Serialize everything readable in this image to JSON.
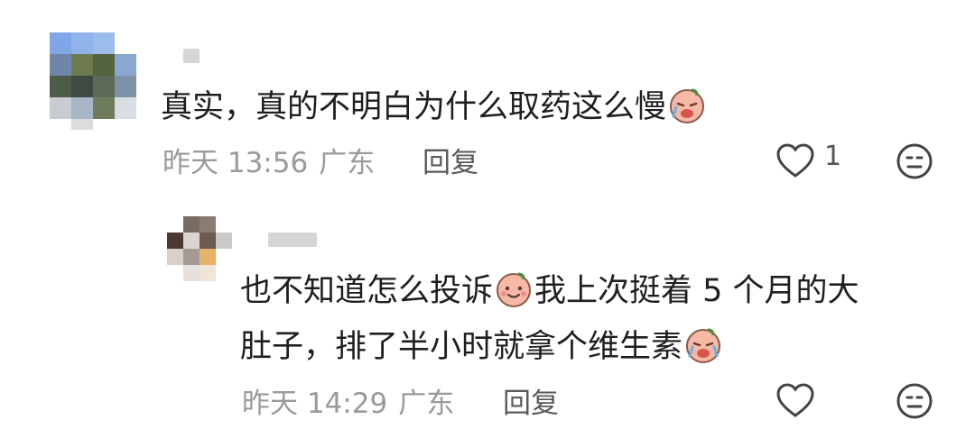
{
  "comments": [
    {
      "text": "真实，真的不明白为什么取药这么慢",
      "emoji_after": "crying-face",
      "time": "昨天 13:56",
      "location": "广东",
      "reply_label": "回复",
      "like_count": "1"
    },
    {
      "text_line1_a": "也不知道怎么投诉",
      "emoji_mid": "smiling-face",
      "text_line1_b": "我上次挺着 5 个月的大",
      "text_line2": "肚子，排了半小时就拿个维生素",
      "emoji_after": "crying-face",
      "time": "昨天 14:29",
      "location": "广东",
      "reply_label": "回复"
    }
  ],
  "icons": {
    "like": "heart-outline-icon",
    "dislike": "neutral-face-icon"
  },
  "colors": {
    "text": "#1f1f1f",
    "meta": "#9a9a9a",
    "reply": "#5a5a5a",
    "emoji": "#f6b9a6"
  }
}
